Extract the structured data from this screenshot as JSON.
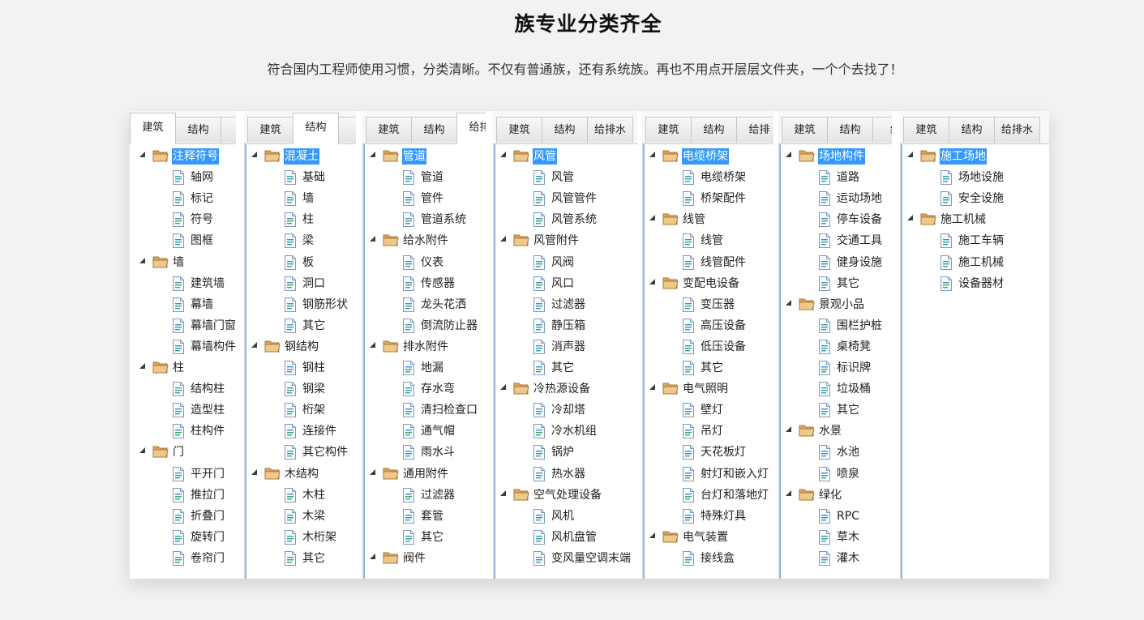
{
  "page": {
    "title": "族专业分类齐全",
    "subtitle": "符合国内工程师使用习惯，分类清晰。不仅有普通族，还有系统族。再也不用点开层层文件夹，一个个去找了！"
  },
  "icons": {
    "folder": "folder-icon",
    "file": "family-file-icon",
    "expand": "expand-triangle-icon"
  },
  "colors": {
    "selection": "#3399ff",
    "folder": "#d9a55e",
    "tree_text": "#1f1f1f"
  },
  "panels": [
    {
      "id": "arch",
      "tabs": [
        "建筑",
        "结构",
        "给"
      ],
      "active_tab": 0,
      "tree": [
        {
          "label": "注释符号",
          "children": [
            "轴网",
            "标记",
            "符号",
            "图框"
          ]
        },
        {
          "label": "墙",
          "children": [
            "建筑墙",
            "幕墙",
            "幕墙门窗",
            "幕墙构件"
          ]
        },
        {
          "label": "柱",
          "children": [
            "结构柱",
            "造型柱",
            "柱构件"
          ]
        },
        {
          "label": "门",
          "children": [
            "平开门",
            "推拉门",
            "折叠门",
            "旋转门",
            "卷帘门"
          ]
        }
      ]
    },
    {
      "id": "struct",
      "tabs": [
        "建筑",
        "结构",
        "给"
      ],
      "active_tab": 1,
      "tree": [
        {
          "label": "混凝土",
          "children": [
            "基础",
            "墙",
            "柱",
            "梁",
            "板",
            "洞口",
            "钢筋形状",
            "其它"
          ]
        },
        {
          "label": "钢结构",
          "children": [
            "钢柱",
            "钢梁",
            "桁架",
            "连接件",
            "其它构件"
          ]
        },
        {
          "label": "木结构",
          "children": [
            "木柱",
            "木梁",
            "木桁架",
            "其它"
          ]
        }
      ]
    },
    {
      "id": "plumb",
      "tabs": [
        "建筑",
        "结构",
        "给排"
      ],
      "active_tab": 2,
      "tree": [
        {
          "label": "管道",
          "children": [
            "管道",
            "管件",
            "管道系统"
          ]
        },
        {
          "label": "给水附件",
          "children": [
            "仪表",
            "传感器",
            "龙头花洒",
            "倒流防止器"
          ]
        },
        {
          "label": "排水附件",
          "children": [
            "地漏",
            "存水弯",
            "清扫检查口",
            "通气帽",
            "雨水斗"
          ]
        },
        {
          "label": "通用附件",
          "children": [
            "过滤器",
            "套管",
            "其它"
          ]
        },
        {
          "label": "阀件",
          "children": []
        }
      ]
    },
    {
      "id": "hvac",
      "tabs": [
        "建筑",
        "结构",
        "给排水"
      ],
      "active_tab": -1,
      "tree": [
        {
          "label": "风管",
          "children": [
            "风管",
            "风管管件",
            "风管系统"
          ]
        },
        {
          "label": "风管附件",
          "children": [
            "风阀",
            "风口",
            "过滤器",
            "静压箱",
            "消声器",
            "其它"
          ]
        },
        {
          "label": "冷热源设备",
          "children": [
            "冷却塔",
            "冷水机组",
            "锅炉",
            "热水器"
          ]
        },
        {
          "label": "空气处理设备",
          "children": [
            "风机",
            "风机盘管",
            "变风量空调末端"
          ]
        }
      ]
    },
    {
      "id": "elec",
      "tabs": [
        "建筑",
        "结构",
        "给排"
      ],
      "active_tab": -1,
      "tree": [
        {
          "label": "电缆桥架",
          "children": [
            "电缆桥架",
            "桥架配件"
          ]
        },
        {
          "label": "线管",
          "children": [
            "线管",
            "线管配件"
          ]
        },
        {
          "label": "变配电设备",
          "children": [
            "变压器",
            "高压设备",
            "低压设备",
            "其它"
          ]
        },
        {
          "label": "电气照明",
          "children": [
            "壁灯",
            "吊灯",
            "天花板灯",
            "射灯和嵌入灯",
            "台灯和落地灯",
            "特殊灯具"
          ]
        },
        {
          "label": "电气装置",
          "children": [
            "接线盒"
          ]
        }
      ]
    },
    {
      "id": "site",
      "tabs": [
        "建筑",
        "结构",
        "给"
      ],
      "active_tab": -1,
      "tree": [
        {
          "label": "场地构件",
          "children": [
            "道路",
            "运动场地",
            "停车设备",
            "交通工具",
            "健身设施",
            "其它"
          ]
        },
        {
          "label": "景观小品",
          "children": [
            "围栏护桩",
            "桌椅凳",
            "标识牌",
            "垃圾桶",
            "其它"
          ]
        },
        {
          "label": "水景",
          "children": [
            "水池",
            "喷泉"
          ]
        },
        {
          "label": "绿化",
          "children": [
            "RPC",
            "草木",
            "灌木"
          ]
        }
      ]
    },
    {
      "id": "constr",
      "tabs": [
        "建筑",
        "结构",
        "给排水"
      ],
      "active_tab": -1,
      "tree": [
        {
          "label": "施工场地",
          "children": [
            "场地设施",
            "安全设施"
          ]
        },
        {
          "label": "施工机械",
          "children": [
            "施工车辆",
            "施工机械",
            "设备器材"
          ]
        }
      ]
    }
  ]
}
